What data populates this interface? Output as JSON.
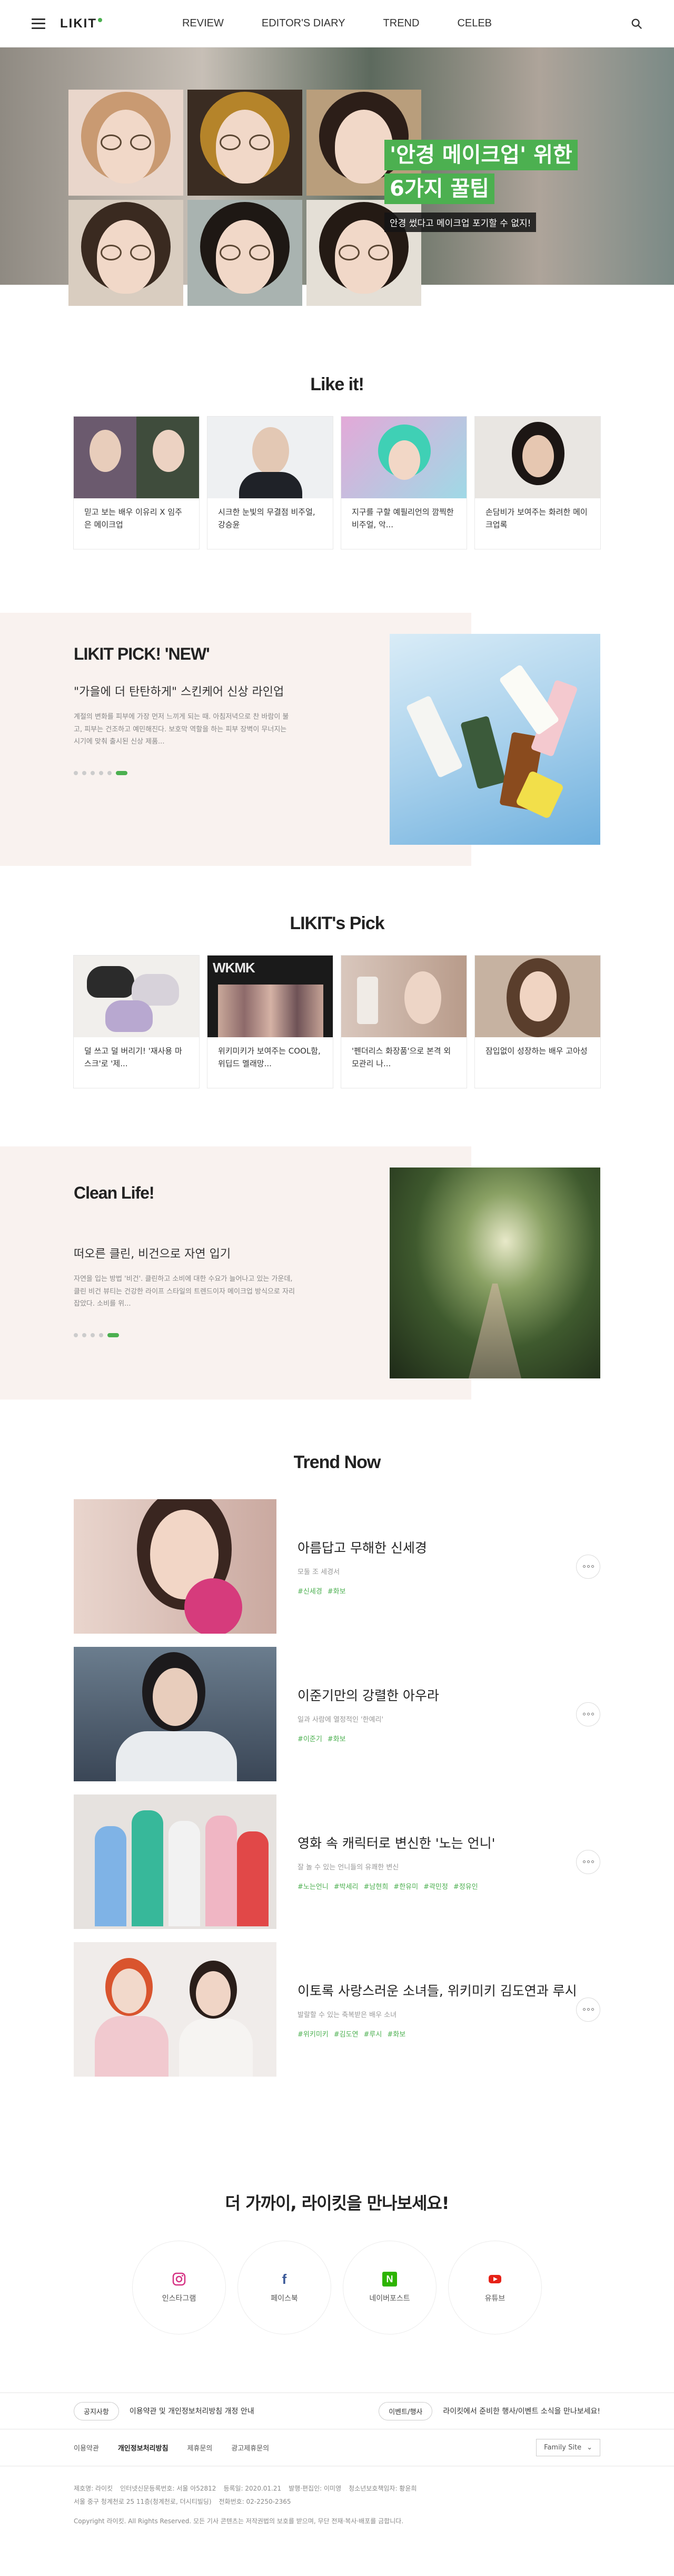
{
  "header": {
    "logo": "LIKIT",
    "nav": [
      "REVIEW",
      "EDITOR'S DIARY",
      "TREND",
      "CELEB"
    ]
  },
  "hero": {
    "line1": "'안경 메이크업' 위한",
    "line2": "6가지 꿀팁",
    "sub": "안경 썼다고 메이크업 포기할 수 없지!"
  },
  "like_it": {
    "title": "Like it!",
    "cards": [
      {
        "text": "믿고 보는 배우 이유리 X 임주은 메이크업"
      },
      {
        "text": "시크한 눈빛의 무결점 비주얼, 강승윤"
      },
      {
        "text": "지구를 구할 예필리언의 깜찍한 비주얼, 악..."
      },
      {
        "text": "손담비가 보여주는 화려한 메이크업록"
      }
    ]
  },
  "likit_pick_new": {
    "title": "LIKIT PICK! 'NEW'",
    "headline": "\"가을에 더 탄탄하게\" 스킨케어 신상 라인업",
    "desc": "계절의 변화를 피부에 가장 먼저 느끼게 되는 때. 아침저녁으로 찬 바람이 불고, 피부는 건조하고 예민해진다. 보호막 역할을 하는 피부 장벽이 무너지는 시기에 맞춰 출시된 신상 제품...",
    "dots": 6,
    "active_dot": 5
  },
  "likit_pick": {
    "title": "LIKIT's Pick",
    "cards": [
      {
        "text": "덜 쓰고 덜 버리기! '재사용 마스크'로 '제..."
      },
      {
        "text": "위키미키가 보여주는 COOL함, 위딥드 멜래망..."
      },
      {
        "text": "'펜더리스 화장품'으로 본격 외모관리 나..."
      },
      {
        "text": "잠입없이 성장하는 배우 고아성"
      }
    ]
  },
  "clean_life": {
    "title": "Clean Life!",
    "headline": "떠오른 클린, 비건으로 자연 입기",
    "desc": "자연을 입는 방법 '비건'. 클린하고 소비에 대한 수요가 늘어나고 있는 가운데, 클린 비건 뷰티는 건강한 라이프 스타일의 트렌드이자 메이크업 방식으로 자리 잡았다. 소비를 위...",
    "dots": 5,
    "active_dot": 4
  },
  "trend_now": {
    "title": "Trend Now",
    "items": [
      {
        "title": "아름답고 무해한 신세경",
        "sub": "모둘 조 세경서",
        "tags": [
          "#신세경",
          "#화보"
        ]
      },
      {
        "title": "이준기만의 강렬한 아우라",
        "sub": "일과 사람에 열정적인 '한예리'",
        "tags": [
          "#이준기",
          "#화보"
        ]
      },
      {
        "title": "영화 속 캐릭터로 변신한 '노는 언니'",
        "sub": "잘 놀 수 있는 언니들의 유쾌한 변신",
        "tags": [
          "#노는언니",
          "#박세리",
          "#남현희",
          "#한유미",
          "#곽민정",
          "#정유인"
        ]
      },
      {
        "title": "이토록 사랑스러운 소녀들, 위키미키 김도연과 루시",
        "sub": "발랄할 수 있는 축복받은 배우 소녀",
        "tags": [
          "#위키미키",
          "#김도연",
          "#루시",
          "#화보"
        ]
      }
    ]
  },
  "social": {
    "title": "더 가까이, 라이킷을 만나보세요!",
    "items": [
      {
        "label": "인스타그램",
        "icon": "instagram-icon",
        "color": "#d63384"
      },
      {
        "label": "페이스북",
        "icon": "facebook-icon",
        "color": "#3b5998"
      },
      {
        "label": "네이버포스트",
        "icon": "naver-icon",
        "color": "#2db400"
      },
      {
        "label": "유튜브",
        "icon": "youtube-icon",
        "color": "#e62117"
      }
    ]
  },
  "footer": {
    "notice_label": "공지사항",
    "notice_text": "이용약관 및 개인정보처리방침 개정 안내",
    "event_label": "이벤트/행사",
    "event_text": "라이킷에서 준비한 행사/이벤트 소식을 만나보세요!",
    "links": [
      "이용약관",
      "개인정보처리방침",
      "제휴문의",
      "광고제휴문의"
    ],
    "family": "Family Site",
    "info_row1": [
      "제호명: 라이킷",
      "인터넷신문등록번호: 서울 아52812",
      "등록일: 2020.01.21",
      "발행·편집인: 이미영",
      "청소년보호책임자: 황윤희"
    ],
    "info_row2": [
      "서울 중구 청계천로 25 11층(청계천로, 더시티빌딩)",
      "전화번호: 02-2250-2365"
    ],
    "copyright": "Copyright 라이킷. All Rights Reserved. 모든 기사 콘텐츠는 저작권법의 보호를 받으며, 무단 전재·복사·배포를 금합니다."
  },
  "colors": {
    "accent": "#4cb050",
    "feature_bg": "#f9f2ef"
  }
}
